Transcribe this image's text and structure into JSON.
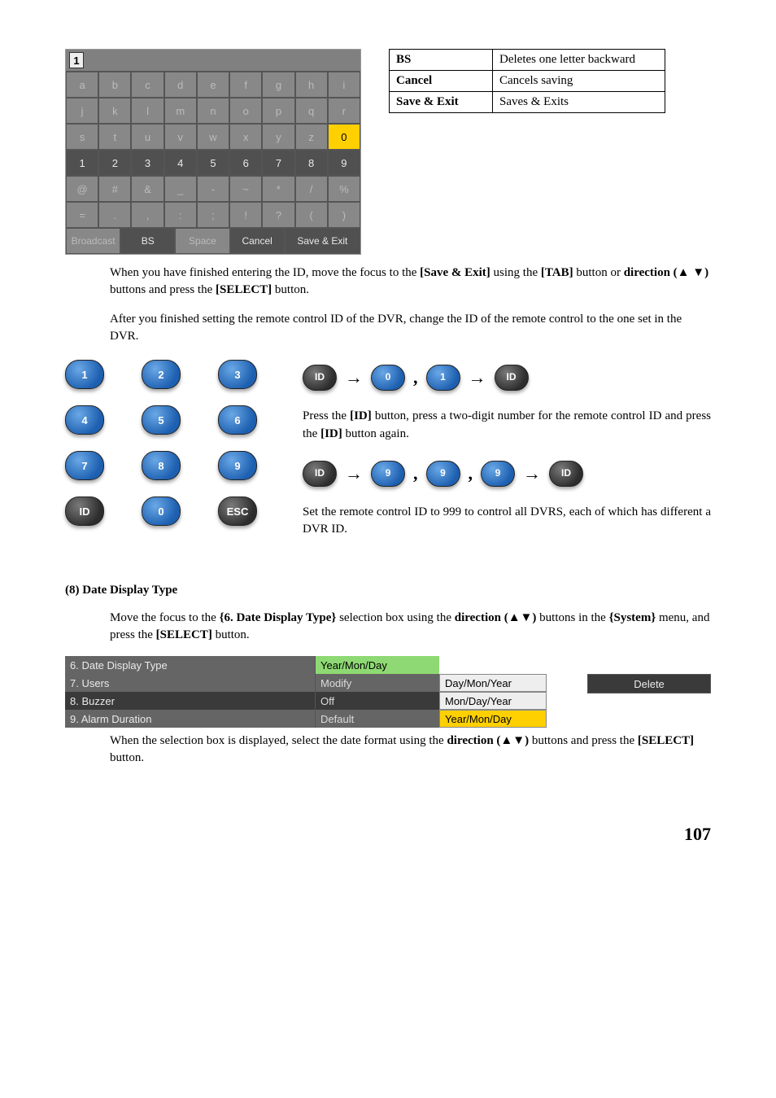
{
  "keyboard": {
    "input_value": "1",
    "rows": [
      [
        {
          "t": "a",
          "s": "dim"
        },
        {
          "t": "b",
          "s": "dim"
        },
        {
          "t": "c",
          "s": "dim"
        },
        {
          "t": "d",
          "s": "dim"
        },
        {
          "t": "e",
          "s": "dim"
        },
        {
          "t": "f",
          "s": "dim"
        },
        {
          "t": "g",
          "s": "dim"
        },
        {
          "t": "h",
          "s": "dim"
        },
        {
          "t": "i",
          "s": "dim"
        }
      ],
      [
        {
          "t": "j",
          "s": "dim"
        },
        {
          "t": "k",
          "s": "dim"
        },
        {
          "t": "l",
          "s": "dim"
        },
        {
          "t": "m",
          "s": "dim"
        },
        {
          "t": "n",
          "s": "dim"
        },
        {
          "t": "o",
          "s": "dim"
        },
        {
          "t": "p",
          "s": "dim"
        },
        {
          "t": "q",
          "s": "dim"
        },
        {
          "t": "r",
          "s": "dim"
        }
      ],
      [
        {
          "t": "s",
          "s": "dim"
        },
        {
          "t": "t",
          "s": "dim"
        },
        {
          "t": "u",
          "s": "dim"
        },
        {
          "t": "v",
          "s": "dim"
        },
        {
          "t": "w",
          "s": "dim"
        },
        {
          "t": "x",
          "s": "dim"
        },
        {
          "t": "y",
          "s": "dim"
        },
        {
          "t": "z",
          "s": "dim"
        },
        {
          "t": "0",
          "s": "hi"
        }
      ],
      [
        {
          "t": "1",
          "s": "on"
        },
        {
          "t": "2",
          "s": "on"
        },
        {
          "t": "3",
          "s": "on"
        },
        {
          "t": "4",
          "s": "on"
        },
        {
          "t": "5",
          "s": "on"
        },
        {
          "t": "6",
          "s": "on"
        },
        {
          "t": "7",
          "s": "on"
        },
        {
          "t": "8",
          "s": "on"
        },
        {
          "t": "9",
          "s": "on"
        }
      ],
      [
        {
          "t": "@",
          "s": "dim"
        },
        {
          "t": "#",
          "s": "dim"
        },
        {
          "t": "&",
          "s": "dim"
        },
        {
          "t": "_",
          "s": "dim"
        },
        {
          "t": "-",
          "s": "dim"
        },
        {
          "t": "~",
          "s": "dim"
        },
        {
          "t": "*",
          "s": "dim"
        },
        {
          "t": "/",
          "s": "dim"
        },
        {
          "t": "%",
          "s": "dim"
        }
      ],
      [
        {
          "t": "=",
          "s": "dim"
        },
        {
          "t": ".",
          "s": "dim"
        },
        {
          "t": ",",
          "s": "dim"
        },
        {
          "t": ":",
          "s": "dim"
        },
        {
          "t": ";",
          "s": "dim"
        },
        {
          "t": "!",
          "s": "dim"
        },
        {
          "t": "?",
          "s": "dim"
        },
        {
          "t": "(",
          "s": "dim"
        },
        {
          "t": ")",
          "s": "dim"
        }
      ]
    ],
    "bottom": [
      {
        "t": "Broadcast",
        "s": "dim"
      },
      {
        "t": "BS",
        "s": "on"
      },
      {
        "t": "Space",
        "s": "dim"
      },
      {
        "t": "Cancel",
        "s": "on"
      },
      {
        "t": "Save & Exit",
        "s": "on"
      }
    ]
  },
  "bs_table": {
    "rows": [
      {
        "k": "BS",
        "v": "Deletes one letter backward"
      },
      {
        "k": "Cancel",
        "v": "Cancels saving"
      },
      {
        "k": "Save & Exit",
        "v": "Saves & Exits"
      }
    ]
  },
  "para1a": "When you have finished entering the ID, move the focus to the ",
  "para1b": "[Save & Exit]",
  "para1c": " using the ",
  "para1d": "[TAB]",
  "para1e": " button or ",
  "para1f": "direction (▲ ▼)",
  "para1g": " buttons and press the ",
  "para1h": "[SELECT]",
  "para1i": " button.",
  "para2": "After you finished setting the remote control ID of the DVR, change the ID of the remote control to the one set in the DVR.",
  "pad": {
    "buttons": [
      "1",
      "2",
      "3",
      "4",
      "5",
      "6",
      "7",
      "8",
      "9",
      "ID",
      "0",
      "ESC"
    ]
  },
  "seq1": [
    "ID",
    "→",
    "0",
    ",",
    "1",
    "→",
    "ID"
  ],
  "seq1_text_a": "Press the ",
  "seq1_text_b": "[ID]",
  "seq1_text_c": " button, press a two-digit number for the remote control ID and press the ",
  "seq1_text_d": "[ID]",
  "seq1_text_e": " button again.",
  "seq2": [
    "ID",
    "→",
    "9",
    ",",
    "9",
    ",",
    "9",
    "→",
    "ID"
  ],
  "seq2_text": "Set the remote control ID to 999 to control all DVRS, each of which has different a DVR ID.",
  "section8": {
    "title": "(8)  Date Display Type",
    "line_a": "Move the focus to the ",
    "line_b": "{6. Date Display Type}",
    "line_c": " selection box using the ",
    "line_d": "direction (▲▼)",
    "line_e": " buttons in the ",
    "line_f": "{System}",
    "line_g": " menu, and press the ",
    "line_h": "[SELECT]",
    "line_i": " button."
  },
  "menu": {
    "rows": [
      {
        "label": "6. Date Display Type",
        "val": "Year/Mon/Day",
        "sel": true,
        "hi": true
      },
      {
        "label": "7. Users",
        "val": "Modify",
        "sel": true,
        "hi": false
      },
      {
        "label": "8. Buzzer",
        "val": "Off",
        "sel": false,
        "hi": false
      },
      {
        "label": "9. Alarm Duration",
        "val": "Default",
        "sel": true,
        "hi": false
      }
    ],
    "options": [
      {
        "t": "Day/Mon/Year",
        "hi": false
      },
      {
        "t": "Mon/Day/Year",
        "hi": false
      },
      {
        "t": "Year/Mon/Day",
        "hi": true
      }
    ],
    "delete_label": "Delete"
  },
  "para3a": "When the selection box is displayed, select the date format using the ",
  "para3b": "direction (▲▼)",
  "para3c": " buttons and press the ",
  "para3d": "[SELECT]",
  "para3e": " button.",
  "page_number": "107"
}
